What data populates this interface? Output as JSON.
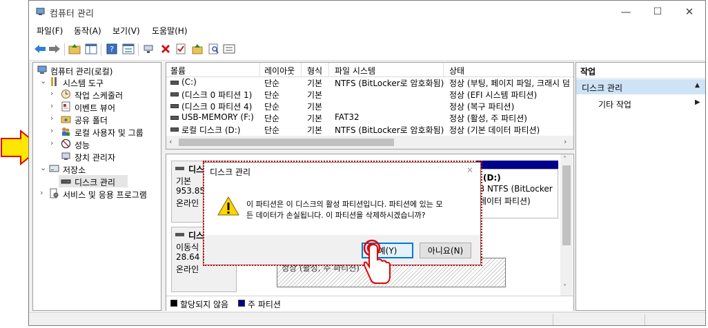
{
  "window": {
    "title": "컴퓨터 관리",
    "controls": {
      "minimize": "—",
      "maximize": "☐",
      "close": "✕"
    }
  },
  "menu": [
    "파일(F)",
    "동작(A)",
    "보기(V)",
    "도움말(H)"
  ],
  "toolbar": {
    "icons": [
      "back-icon",
      "forward-icon",
      "up-folder-icon",
      "show-tree-icon",
      "help-icon",
      "properties-icon",
      "connect-icon",
      "delete-icon",
      "check-icon",
      "export-icon",
      "search-icon",
      "new-icon"
    ]
  },
  "tree": {
    "items": [
      {
        "label": "컴퓨터 관리(로컬)",
        "icon": "computer-management-icon"
      },
      {
        "label": "시스템 도구",
        "icon": "tools-icon"
      },
      {
        "label": "작업 스케줄러",
        "icon": "clock-icon"
      },
      {
        "label": "이벤트 뷰어",
        "icon": "event-viewer-icon"
      },
      {
        "label": "공유 폴더",
        "icon": "shared-folder-icon"
      },
      {
        "label": "로컬 사용자 및 그룹",
        "icon": "users-icon"
      },
      {
        "label": "성능",
        "icon": "performance-icon"
      },
      {
        "label": "장치 관리자",
        "icon": "device-manager-icon"
      },
      {
        "label": "저장소",
        "icon": "storage-icon"
      },
      {
        "label": "디스크 관리",
        "icon": "disk-icon"
      },
      {
        "label": "서비스 및 응용 프로그램",
        "icon": "services-icon"
      }
    ]
  },
  "volumes": {
    "headers": [
      "볼륨",
      "레이아웃",
      "형식",
      "파일 시스템",
      "상태"
    ],
    "rows": [
      {
        "name": "(C:)",
        "layout": "단순",
        "type": "기본",
        "fs": "NTFS (BitLocker로 암호화됨)",
        "status": "정상 (부팅, 페이지 파일, 크래시 덤"
      },
      {
        "name": "(디스크 0 파티션 1)",
        "layout": "단순",
        "type": "기본",
        "fs": "",
        "status": "정상 (EFI 시스템 파티션)"
      },
      {
        "name": "(디스크 0 파티션 4)",
        "layout": "단순",
        "type": "기본",
        "fs": "",
        "status": "정상 (복구 파티션)"
      },
      {
        "name": "USB-MEMORY (F:)",
        "layout": "단순",
        "type": "기본",
        "fs": "FAT32",
        "status": "정상 (활성, 주 파티션)"
      },
      {
        "name": "로컬 디스크 (D:)",
        "layout": "단순",
        "type": "기본",
        "fs": "NTFS (BitLocker로 암호화됨)",
        "status": "정상 (기본 데이터 파티션)"
      }
    ]
  },
  "disk_map": {
    "disk0": {
      "name": "디스",
      "type": "기본",
      "size": "953.85 G",
      "state": "온라인",
      "partition_d_name": "(D:)",
      "partition_d_fs": "B NTFS (BitLocker",
      "partition_d_status": "데이터 파티션)"
    },
    "disk1": {
      "name": "디스",
      "type": "이동식",
      "size": "28.64 G",
      "state": "온라인",
      "partition_status": "정상 (활성, 주 파티션)"
    }
  },
  "legend": {
    "unallocated": "할당되지 않음",
    "primary": "주 파티션",
    "unallocated_color": "#000000",
    "primary_color": "#00008b"
  },
  "actions": {
    "title": "작업",
    "section": "디스크 관리",
    "more": "기타 작업",
    "section_color": "#cfe3f7"
  },
  "dialog": {
    "title": "디스크 관리",
    "message_line1": "이 파티션은 이 디스크의 활성 파티션입니다. 파티션에 있는 모",
    "message_line2": "든 데이터가 손실됩니다. 이 파티션을 삭제하시겠습니까?",
    "yes_label": "예(Y)",
    "no_label": "아니요(N)",
    "close": "✕",
    "icon": "warning-icon"
  },
  "annotation": {
    "arrow_color": "#ffe600",
    "arrow_border": "#e00000",
    "outline_color": "#d00000"
  }
}
